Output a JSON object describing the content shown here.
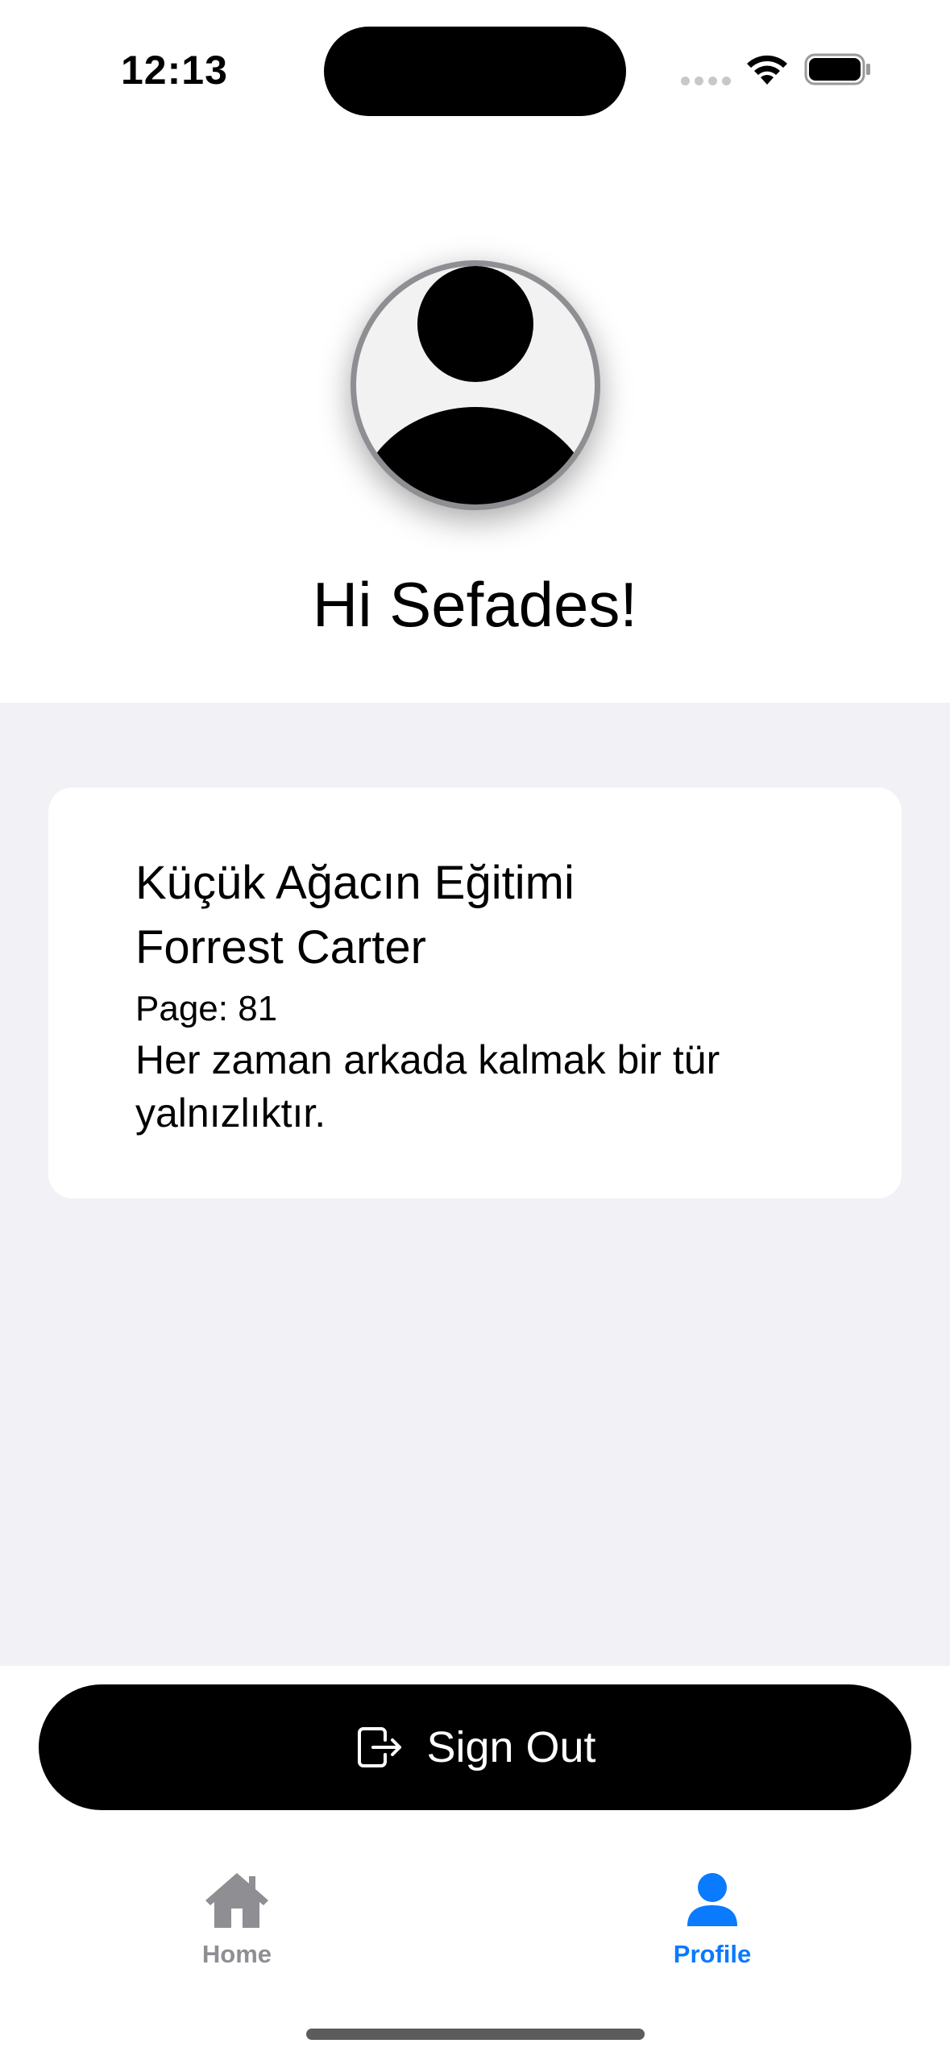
{
  "status_bar": {
    "time": "12:13",
    "icons": [
      "cellular-signal-icon",
      "wifi-icon",
      "battery-icon"
    ]
  },
  "header": {
    "avatar_icon": "person-avatar-icon",
    "greeting": "Hi Sefades!"
  },
  "quote_card": {
    "book_title": "Küçük Ağacın Eğitimi",
    "author": "Forrest Carter",
    "page": "Page: 81",
    "quote": "Her zaman arkada kalmak bir tür yalnızlıktır."
  },
  "signout": {
    "icon": "sign-out-icon",
    "label": "Sign Out"
  },
  "tab_bar": {
    "tabs": [
      {
        "label": "Home",
        "icon": "house-icon",
        "selected": false
      },
      {
        "label": "Profile",
        "icon": "person-icon",
        "selected": true
      }
    ],
    "active_color": "#0a7aff",
    "inactive_color": "#8e8e93"
  },
  "colors": {
    "content_background": "#f1f1f6",
    "button_background": "#000000"
  }
}
